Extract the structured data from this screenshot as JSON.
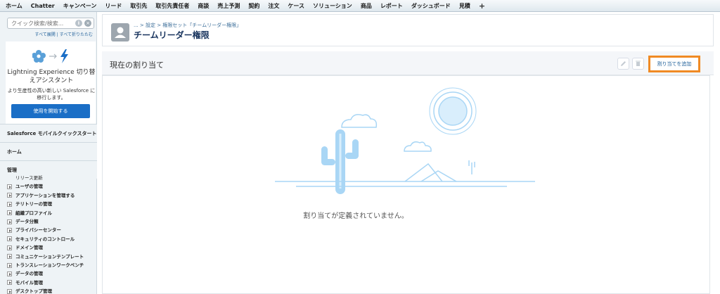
{
  "topnav": {
    "tabs": [
      "ホーム",
      "Chatter",
      "キャンペーン",
      "リード",
      "取引先",
      "取引先責任者",
      "商談",
      "売上予測",
      "契約",
      "注文",
      "ケース",
      "ソリューション",
      "商品",
      "レポート",
      "ダッシュボード",
      "見積"
    ],
    "more": "+"
  },
  "sidebar": {
    "search_placeholder": "クイック検索/検索...",
    "search_links": {
      "expand": "すべて展開",
      "separator": " | ",
      "collapse": "すべて折りたたむ"
    },
    "lightning": {
      "title": "Lightning Experience 切り替えアシスタント",
      "subtitle": "より生産性の高い新しい Salesforce に移行します。",
      "button": "使用を開始する"
    },
    "sections": {
      "mobile": "Salesforce モバイルクイックスタート",
      "home": "ホーム",
      "admin": "管理"
    },
    "tree": [
      {
        "label": "リリース更新",
        "expandable": false
      },
      {
        "label": "ユーザの管理",
        "expandable": true
      },
      {
        "label": "アプリケーションを管理する",
        "expandable": true
      },
      {
        "label": "テリトリーの管理",
        "expandable": true
      },
      {
        "label": "組織プロファイル",
        "expandable": true
      },
      {
        "label": "データ分類",
        "expandable": true
      },
      {
        "label": "プライバシーセンター",
        "expandable": true
      },
      {
        "label": "セキュリティのコントロール",
        "expandable": true
      },
      {
        "label": "ドメイン管理",
        "expandable": true
      },
      {
        "label": "コミュニケーションテンプレート",
        "expandable": true
      },
      {
        "label": "トランスレーションワークベンチ",
        "expandable": true
      },
      {
        "label": "データの管理",
        "expandable": true
      },
      {
        "label": "モバイル管理",
        "expandable": true
      },
      {
        "label": "デスクトップ管理",
        "expandable": true
      }
    ]
  },
  "header": {
    "breadcrumb": "... > 設定 > 権限セット「チームリーダー権限」",
    "title": "チームリーダー権限"
  },
  "section": {
    "title": "現在の割り当て",
    "add_button": "割り当てを追加"
  },
  "empty": {
    "message": "割り当てが定義されていません。"
  },
  "colors": {
    "accent": "#1a6ec6",
    "highlight": "#f08a24",
    "illustration": "#a9d6f5"
  }
}
